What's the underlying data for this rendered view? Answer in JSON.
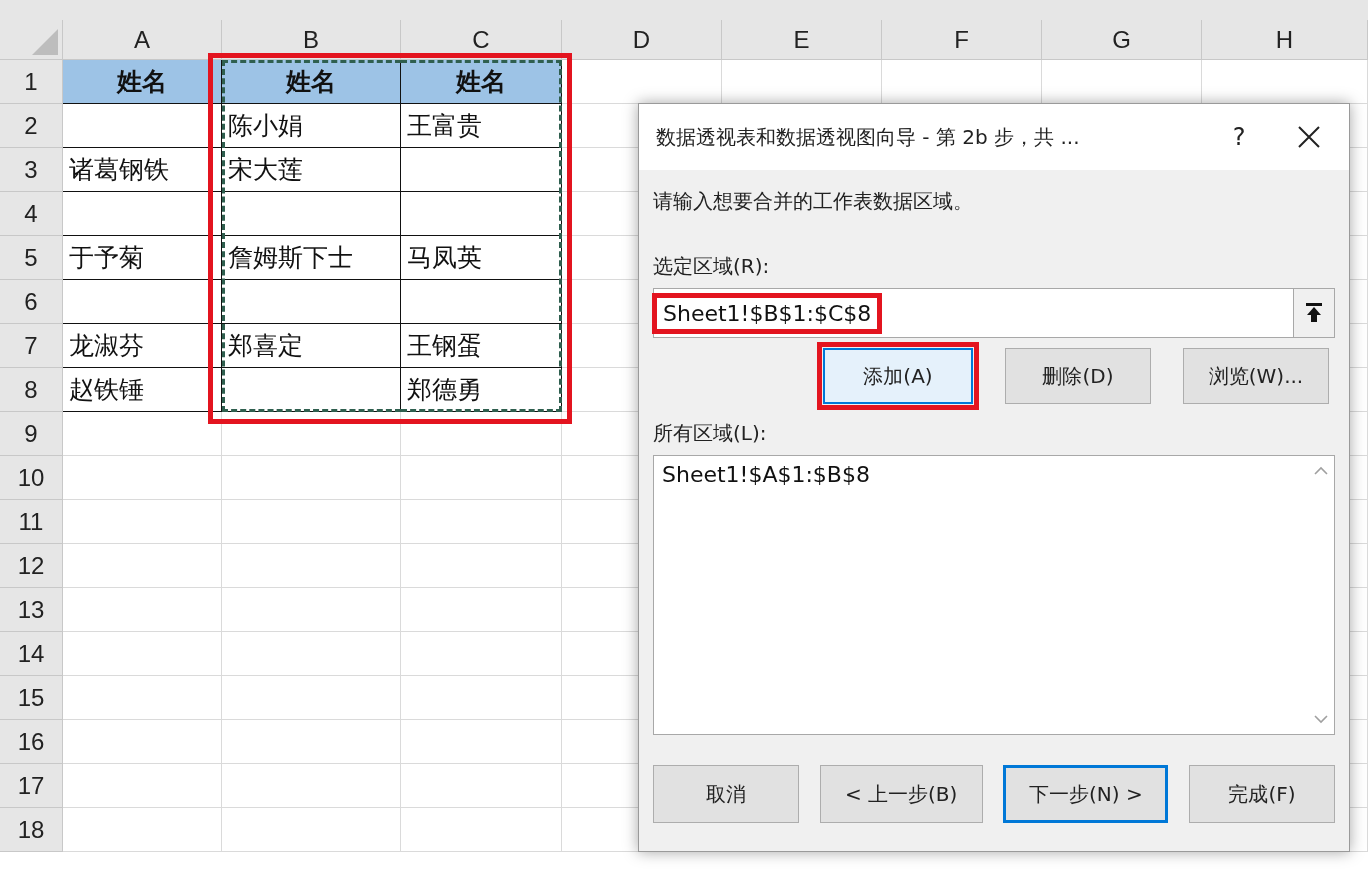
{
  "sheet": {
    "highlight_frame": true,
    "columns": [
      {
        "label": "A",
        "marked": false
      },
      {
        "label": "B",
        "marked": true
      },
      {
        "label": "C",
        "marked": true
      },
      {
        "label": "D",
        "marked": false
      },
      {
        "label": "E",
        "marked": false
      },
      {
        "label": "F",
        "marked": false
      },
      {
        "label": "G",
        "marked": false
      },
      {
        "label": "H",
        "marked": false
      }
    ],
    "rows": [
      {
        "number": "1",
        "kind": "header",
        "cells": [
          "姓名",
          "姓名",
          "姓名"
        ]
      },
      {
        "number": "2",
        "kind": "data",
        "cells": [
          null,
          "陈小娟",
          "王富贵"
        ]
      },
      {
        "number": "3",
        "kind": "data",
        "cells": [
          "诸葛钢铁",
          "宋大莲",
          null
        ]
      },
      {
        "number": "4",
        "kind": "data",
        "cells": [
          null,
          null,
          null
        ]
      },
      {
        "number": "5",
        "kind": "data",
        "cells": [
          "于予菊",
          "詹姆斯下士",
          "马凤英"
        ]
      },
      {
        "number": "6",
        "kind": "data",
        "cells": [
          null,
          null,
          null
        ]
      },
      {
        "number": "7",
        "kind": "data",
        "cells": [
          "龙淑芬",
          "郑喜定",
          "王钢蛋"
        ]
      },
      {
        "number": "8",
        "kind": "data",
        "cells": [
          "赵铁锤",
          null,
          "郑德勇"
        ]
      },
      {
        "number": "9",
        "kind": "blank"
      },
      {
        "number": "10",
        "kind": "blank"
      },
      {
        "number": "11",
        "kind": "blank"
      },
      {
        "number": "12",
        "kind": "blank"
      },
      {
        "number": "13",
        "kind": "blank"
      },
      {
        "number": "14",
        "kind": "blank"
      },
      {
        "number": "15",
        "kind": "blank"
      },
      {
        "number": "16",
        "kind": "blank"
      },
      {
        "number": "17",
        "kind": "blank"
      },
      {
        "number": "18",
        "kind": "blank"
      }
    ]
  },
  "dialog": {
    "title": "数据透视表和数据透视图向导 - 第 2b 步，共 ...",
    "help": "?",
    "prompt": "请输入想要合并的工作表数据区域。",
    "range_label": "选定区域(R):",
    "range_field": {
      "value": "Sheet1!$B$1:$C$8",
      "highlighted": true
    },
    "range_buttons": [
      {
        "label": "添加(A)",
        "highlighted": true,
        "focused": true
      },
      {
        "label": "删除(D)",
        "highlighted": false,
        "focused": false
      },
      {
        "label": "浏览(W)...",
        "highlighted": false,
        "focused": false
      }
    ],
    "all_label": "所有区域(L):",
    "all_ranges": [
      "Sheet1!$A$1:$B$8"
    ],
    "footer_buttons": [
      {
        "label": "取消",
        "default": false
      },
      {
        "label": "< 上一步(B)",
        "default": false
      },
      {
        "label": "下一步(N) >",
        "default": true
      },
      {
        "label": "完成(F)",
        "default": false
      }
    ]
  }
}
